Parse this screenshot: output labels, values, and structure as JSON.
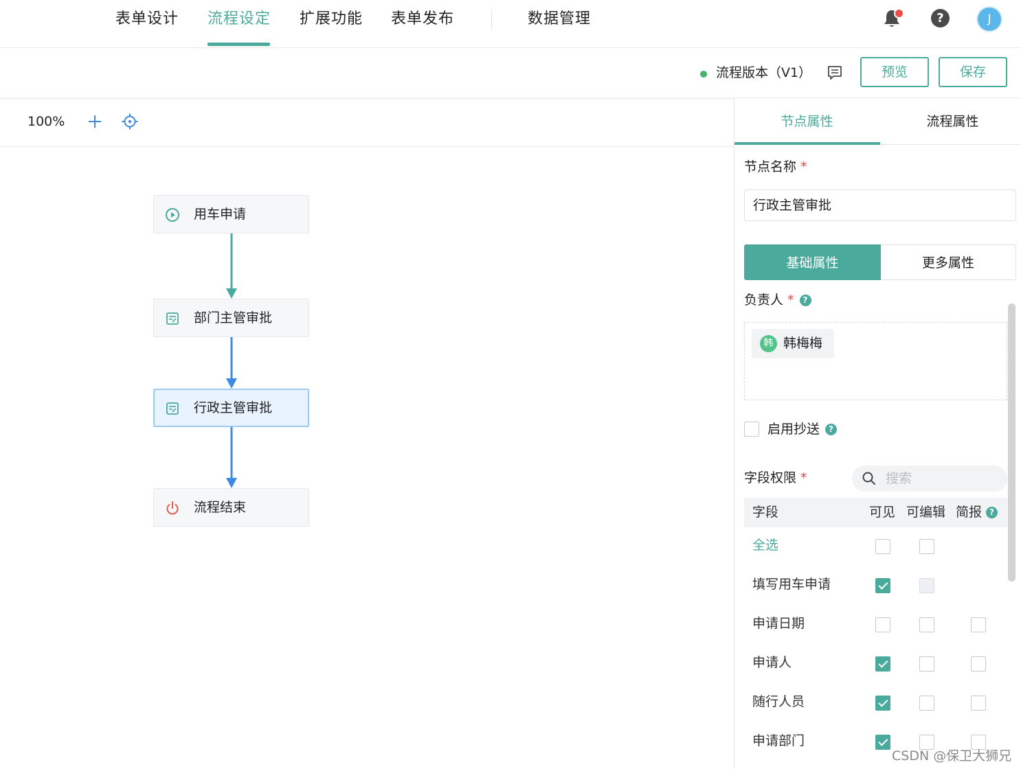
{
  "nav": {
    "tabs": [
      {
        "label": "表单设计"
      },
      {
        "label": "流程设定"
      },
      {
        "label": "扩展功能"
      },
      {
        "label": "表单发布"
      },
      {
        "label": "数据管理"
      }
    ],
    "active_tab": "流程设定",
    "avatar_initial": "J",
    "accent_color": "#4aaa9c"
  },
  "toolbar": {
    "version_label": "流程版本（V1）",
    "preview_label": "预览",
    "save_label": "保存"
  },
  "canvas": {
    "zoom": "100%",
    "nodes": [
      {
        "label": "用车申请",
        "icon": "play-circle-icon"
      },
      {
        "label": "部门主管审批",
        "icon": "form-icon"
      },
      {
        "label": "行政主管审批",
        "icon": "form-icon",
        "selected": true
      },
      {
        "label": "流程结束",
        "icon": "power-icon"
      }
    ]
  },
  "panel": {
    "tabs": [
      {
        "label": "节点属性"
      },
      {
        "label": "流程属性"
      }
    ],
    "node_name_label": "节点名称",
    "node_name_value": "行政主管审批",
    "segments": [
      {
        "label": "基础属性"
      },
      {
        "label": "更多属性"
      }
    ],
    "assignee_label": "负责人",
    "assignees": [
      {
        "avatar": "韩",
        "name": "韩梅梅"
      }
    ],
    "cc_label": "启用抄送",
    "field_perm_label": "字段权限",
    "search_placeholder": "搜索",
    "table": {
      "headers": [
        "字段",
        "可见",
        "可编辑",
        "简报"
      ],
      "select_all": "全选",
      "rows": [
        {
          "label": "填写用车申请",
          "visible": true,
          "editable": false,
          "editable_disabled": true,
          "brief": null
        },
        {
          "label": "申请日期",
          "visible": false,
          "editable": false,
          "brief": false
        },
        {
          "label": "申请人",
          "visible": true,
          "editable": false,
          "brief": false
        },
        {
          "label": "随行人员",
          "visible": true,
          "editable": false,
          "brief": false
        },
        {
          "label": "申请部门",
          "visible": true,
          "editable": false,
          "brief": false
        }
      ]
    }
  },
  "watermark": "CSDN @保卫大狮兄"
}
